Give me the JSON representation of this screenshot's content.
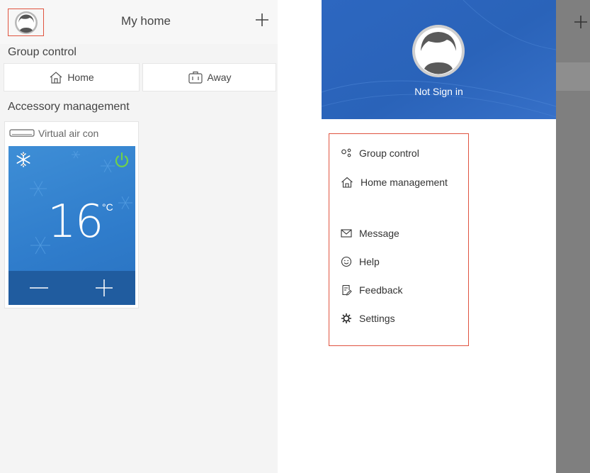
{
  "left": {
    "header": {
      "title": "My home"
    },
    "group_control": {
      "label": "Group control",
      "buttons": [
        {
          "label": "Home",
          "icon": "home-icon"
        },
        {
          "label": "Away",
          "icon": "luggage-icon"
        }
      ]
    },
    "accessory": {
      "label": "Accessory management",
      "device": {
        "name": "Virtual air con",
        "mode_icon": "snowflake-icon",
        "power_icon": "power-icon",
        "temperature": "16",
        "unit": "°C"
      }
    }
  },
  "right": {
    "drawer": {
      "user_status": "Not Sign in",
      "menu": [
        {
          "label": "Group control",
          "icon": "group-control-icon"
        },
        {
          "label": "Home management",
          "icon": "home-icon"
        },
        {
          "label": "Message",
          "icon": "envelope-icon"
        },
        {
          "label": "Help",
          "icon": "smiley-icon"
        },
        {
          "label": "Feedback",
          "icon": "feedback-icon"
        },
        {
          "label": "Settings",
          "icon": "gear-icon"
        }
      ]
    }
  },
  "colors": {
    "highlight": "#e0533f",
    "ac_panel": "#3e8ed6",
    "ac_bottom": "#205c9f",
    "power_green": "#6fd14b",
    "drawer_header": "#2d67c0"
  }
}
